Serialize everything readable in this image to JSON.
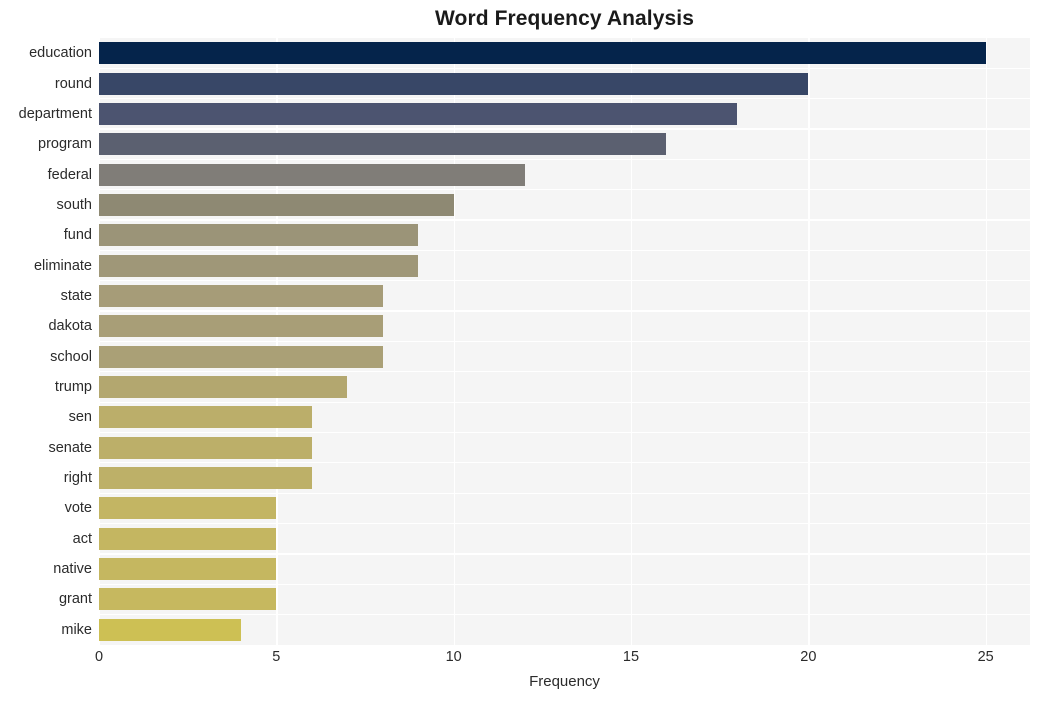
{
  "chart_data": {
    "type": "bar",
    "orientation": "horizontal",
    "title": "Word Frequency Analysis",
    "xlabel": "Frequency",
    "ylabel": "",
    "xlim": [
      0,
      26.25
    ],
    "xticks": [
      0,
      5,
      10,
      15,
      20,
      25
    ],
    "xtick_labels": [
      "0",
      "5",
      "10",
      "15",
      "20",
      "25"
    ],
    "grid": true,
    "legend": null,
    "categories": [
      "education",
      "round",
      "department",
      "program",
      "federal",
      "south",
      "fund",
      "eliminate",
      "state",
      "dakota",
      "school",
      "trump",
      "sen",
      "senate",
      "right",
      "vote",
      "act",
      "native",
      "grant",
      "mike"
    ],
    "values": [
      25,
      20,
      18,
      16,
      12,
      10,
      9,
      9,
      8,
      8,
      8,
      7,
      6,
      6,
      6,
      5,
      5,
      5,
      5,
      4
    ],
    "bar_colors": [
      "#05244b",
      "#384767",
      "#4c5470",
      "#5b6070",
      "#807d78",
      "#8e8973",
      "#9b9478",
      "#9f9778",
      "#a69c78",
      "#a89e77",
      "#aaa076",
      "#b3a76f",
      "#bbae6a",
      "#bcaf69",
      "#bdb068",
      "#c3b563",
      "#c4b661",
      "#c5b760",
      "#c6b85f",
      "#cdc054"
    ],
    "plot_background": "#f5f5f5",
    "grid_color": "#ffffff",
    "figure_background": "#ffffff"
  }
}
